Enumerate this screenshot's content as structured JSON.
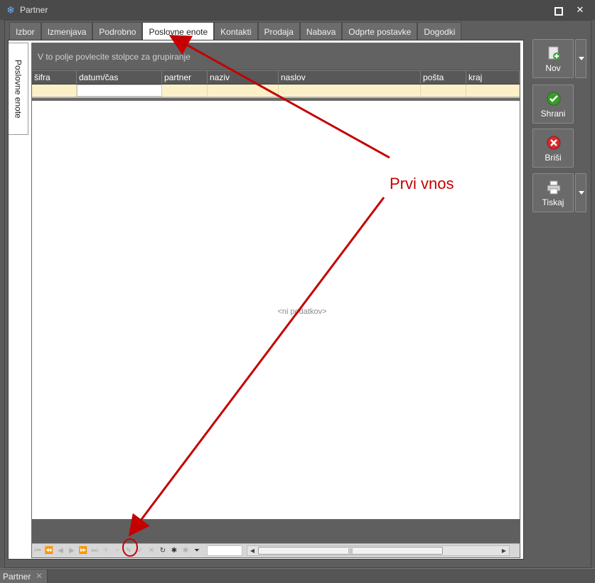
{
  "window": {
    "title": "Partner",
    "controls": {
      "maximize": "□",
      "close": "✕"
    }
  },
  "tabs": [
    {
      "label": "Izbor",
      "active": false
    },
    {
      "label": "Izmenjava",
      "active": false
    },
    {
      "label": "Podrobno",
      "active": false
    },
    {
      "label": "Poslovne enote",
      "active": true
    },
    {
      "label": "Kontakti",
      "active": false
    },
    {
      "label": "Prodaja",
      "active": false
    },
    {
      "label": "Nabava",
      "active": false
    },
    {
      "label": "Odprte postavke",
      "active": false
    },
    {
      "label": "Dogodki",
      "active": false
    }
  ],
  "vertical_tab": {
    "label": "Poslovne enote"
  },
  "grid": {
    "group_panel_text": "V to polje povlecite stolpce za grupiranje",
    "columns": [
      "šifra",
      "datum/čas",
      "partner",
      "naziv",
      "naslov",
      "pošta",
      "kraj"
    ],
    "empty_text": "<ni podatkov>"
  },
  "sidebar": {
    "new_label": "Nov",
    "save_label": "Shrani",
    "delete_label": "Briši",
    "print_label": "Tiskaj"
  },
  "taskbar": {
    "item_label": "Partner",
    "close_glyph": "✕"
  },
  "annotation": {
    "text": "Prvi vnos",
    "color": "#c40000"
  },
  "colors": {
    "active_tab": "#ffffff",
    "new_row": "#fbf0c8",
    "dark_panel": "#5e5e5e",
    "annotation_red": "#c40000"
  }
}
